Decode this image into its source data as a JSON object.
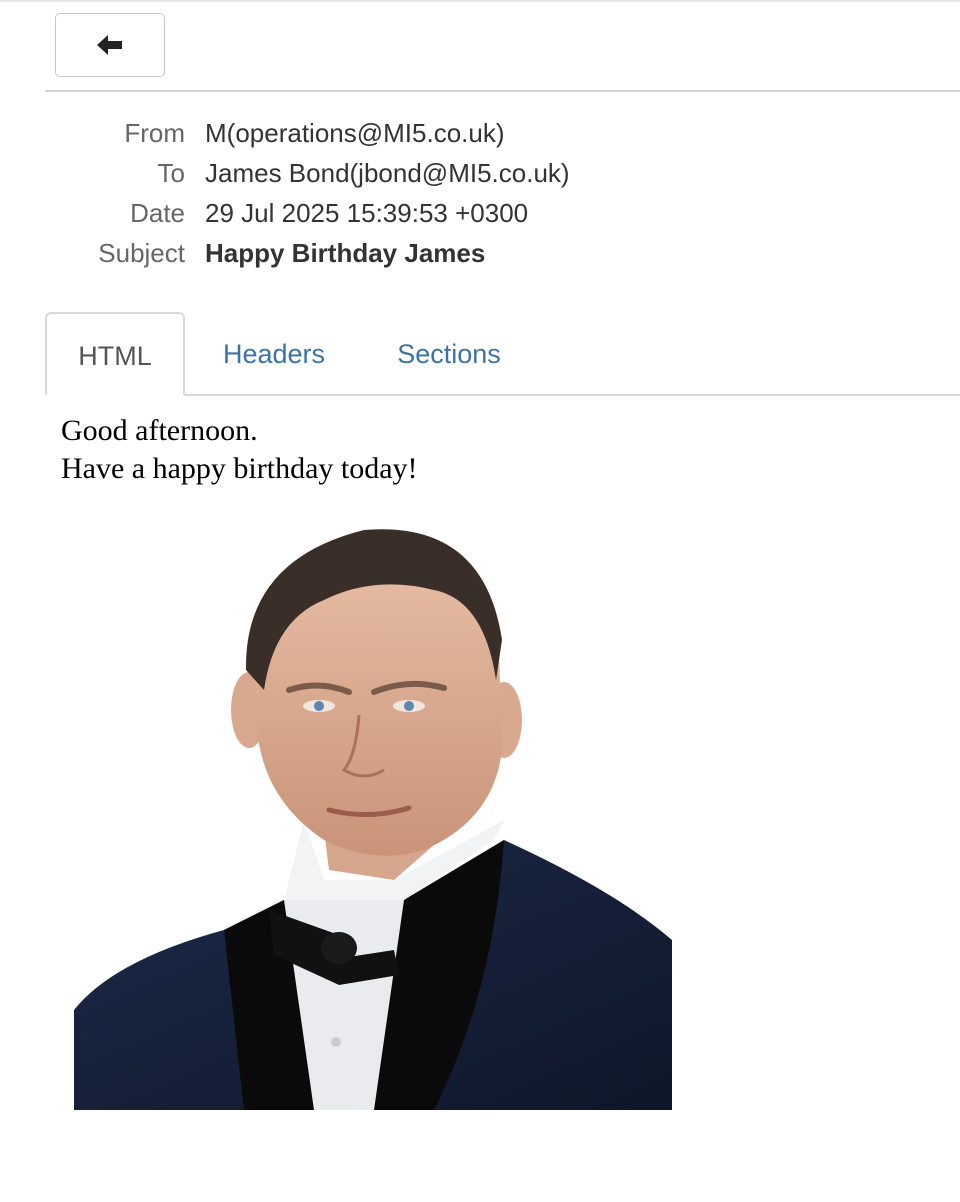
{
  "toolbar": {
    "back_icon": "arrow-left-icon"
  },
  "header": {
    "from_label": "From",
    "from_value": "M(operations@MI5.co.uk)",
    "to_label": "To",
    "to_value": "James Bond(jbond@MI5.co.uk)",
    "date_label": "Date",
    "date_value": "29 Jul 2025 15:39:53 +0300",
    "subject_label": "Subject",
    "subject_value": "Happy Birthday James"
  },
  "tabs": [
    {
      "label": "HTML",
      "active": true
    },
    {
      "label": "Headers",
      "active": false
    },
    {
      "label": "Sections",
      "active": false
    }
  ],
  "message": {
    "line1": "Good afternoon.",
    "line2": "Have a happy birthday today!"
  },
  "colors": {
    "link": "#3b73a8",
    "label": "#666666",
    "border": "#d9d9d9"
  }
}
